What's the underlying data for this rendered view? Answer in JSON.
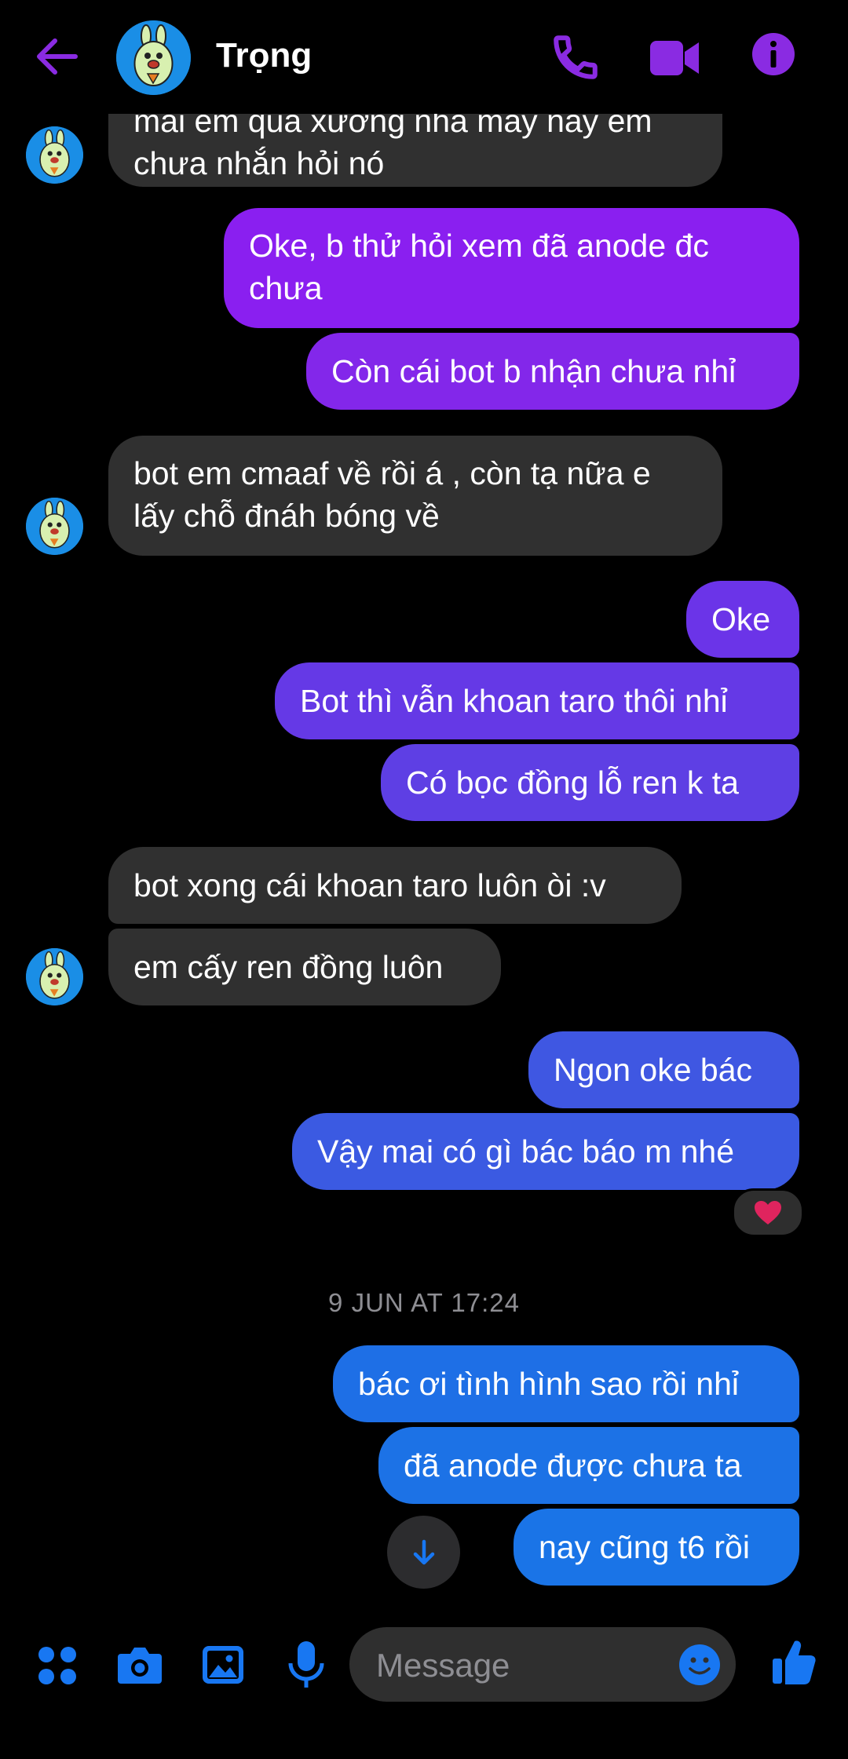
{
  "header": {
    "contact_name": "Trọng",
    "accent_color": "#8a2be2",
    "icons": [
      "back-arrow-icon",
      "phone-icon",
      "video-camera-icon",
      "info-icon"
    ]
  },
  "messages": [
    {
      "side": "in",
      "text": "Mai em qua xưởng nhà máy nay em chưa nhắn hỏi nó",
      "visible_lines": [
        "mai em qua xưởng nhà máy nay em",
        "chưa nhắn hỏi nó"
      ]
    },
    {
      "side": "out",
      "text": "Oke, b thử hỏi xem đã anode đc chưa",
      "color": "#8a1ff0"
    },
    {
      "side": "out",
      "text": "Còn cái bot b nhận chưa nhỉ",
      "color": "#8327ea"
    },
    {
      "side": "in",
      "text": "bot em cmaaf về rồi á , còn tạ nữa e lấy chỗ đnáh bóng về"
    },
    {
      "side": "out",
      "text": "Oke",
      "color": "#6b34e8"
    },
    {
      "side": "out",
      "text": "Bot thì vẫn khoan taro thôi nhỉ",
      "color": "#6539e6"
    },
    {
      "side": "out",
      "text": "Có bọc đồng lỗ ren k ta",
      "color": "#5e3fe4"
    },
    {
      "side": "in",
      "text": "bot xong cái khoan taro luôn òi :v"
    },
    {
      "side": "in",
      "text": "em cấy ren đồng luôn"
    },
    {
      "side": "out",
      "text": "Ngon oke bác",
      "color": "#3f57e2"
    },
    {
      "side": "out",
      "text": "Vậy mai có gì bác báo m nhé",
      "color": "#3b5ae2",
      "reaction": "❤️"
    },
    {
      "side": "out",
      "text": "bác ơi tình hình sao rồi nhỉ",
      "color": "#1e6fe6"
    },
    {
      "side": "out",
      "text": "đã anode được chưa ta",
      "color": "#1c72e6"
    },
    {
      "side": "out",
      "text": "nay cũng t6 rồi",
      "color": "#1a74e7"
    }
  ],
  "timestamp": "9 JUN AT 17:24",
  "composer": {
    "placeholder": "Message",
    "accent_color": "#1877f2",
    "icons": [
      "apps-grid-icon",
      "camera-icon",
      "gallery-icon",
      "microphone-icon",
      "emoji-icon",
      "thumbs-up-icon"
    ]
  },
  "scroll_down_icon": "arrow-down-icon",
  "incoming_bubble_color": "#303030"
}
